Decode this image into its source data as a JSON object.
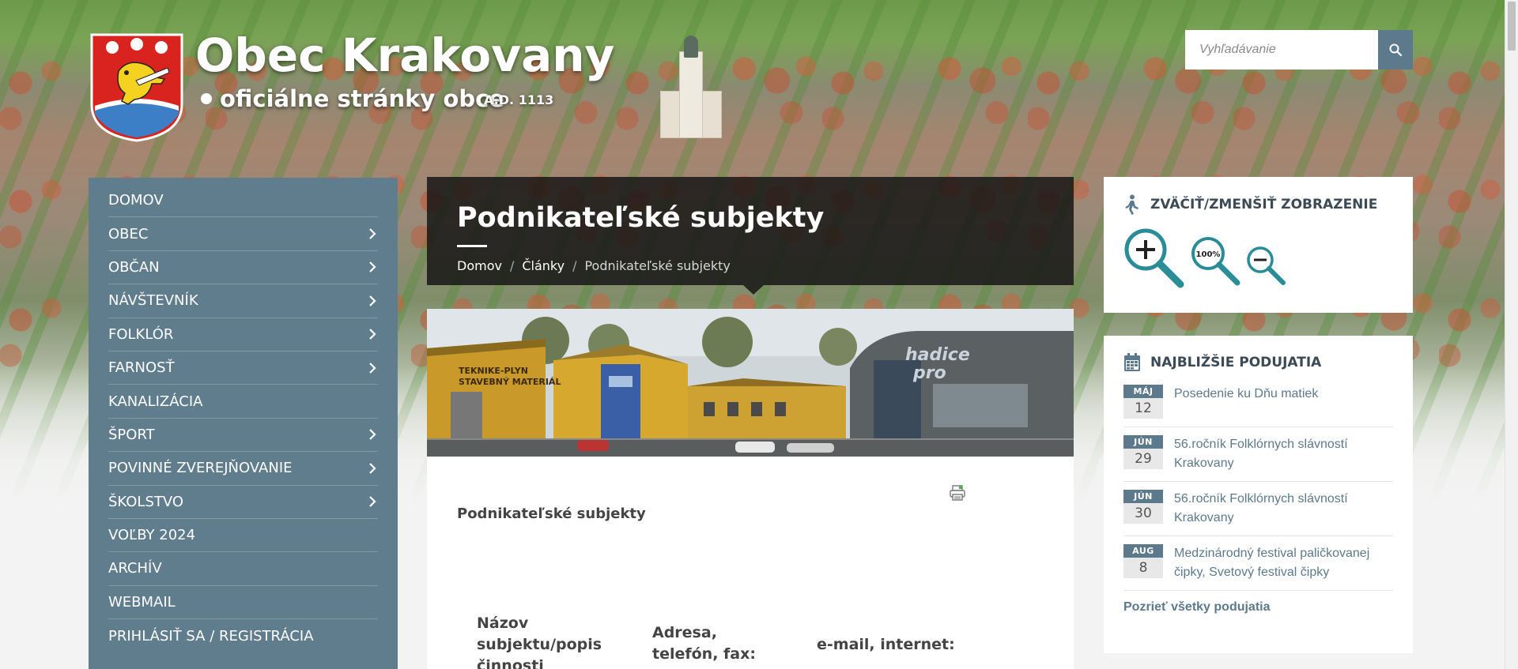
{
  "header": {
    "title": "Obec Krakovany",
    "subtitle": "oficiálne stránky obce",
    "year": "A.D. 1113"
  },
  "search": {
    "placeholder": "Vyhľadávanie"
  },
  "nav": {
    "items": [
      {
        "label": "DOMOV",
        "submenu": false
      },
      {
        "label": "OBEC",
        "submenu": true
      },
      {
        "label": "OBČAN",
        "submenu": true
      },
      {
        "label": "NÁVŠTEVNÍK",
        "submenu": true
      },
      {
        "label": "FOLKLÓR",
        "submenu": true
      },
      {
        "label": "FARNOSŤ",
        "submenu": true
      },
      {
        "label": "KANALIZÁCIA",
        "submenu": false
      },
      {
        "label": "ŠPORT",
        "submenu": true
      },
      {
        "label": "POVINNÉ ZVEREJŇOVANIE",
        "submenu": true
      },
      {
        "label": "ŠKOLSTVO",
        "submenu": true
      },
      {
        "label": "VOĽBY 2024",
        "submenu": false
      },
      {
        "label": "ARCHÍV",
        "submenu": false
      },
      {
        "label": "WEBMAIL",
        "submenu": false
      },
      {
        "label": "PRIHLÁSIŤ SA / REGISTRÁCIA",
        "submenu": false
      }
    ]
  },
  "page": {
    "title": "Podnikateľské subjekty",
    "breadcrumb": [
      "Domov",
      "Články",
      "Podnikateľské subjekty"
    ],
    "hero_signs": [
      "hadice",
      "pro",
      "TEKNIKE-PLYN",
      "STAVEBNÝ MATERIÁL"
    ],
    "content_heading": "Podnikateľské subjekty",
    "table_headers": [
      "Názov subjektu/popis činnosti",
      "Adresa, telefón, fax:",
      "e-mail, internet:"
    ]
  },
  "zoom_widget": {
    "title": "ZVÄČIŤ/ZMENŠIŤ ZOBRAZENIE",
    "reset_label": "100%"
  },
  "events_widget": {
    "title": "NAJBLIŽŠIE PODUJATIA",
    "events": [
      {
        "month": "MÁJ",
        "day": "12",
        "title": "Posedenie ku Dňu matiek"
      },
      {
        "month": "JÚN",
        "day": "29",
        "title": "56.ročník Folklórnych slávností Krakovany"
      },
      {
        "month": "JÚN",
        "day": "30",
        "title": "56.ročník Folklórnych slávností Krakovany"
      },
      {
        "month": "AUG",
        "day": "8",
        "title": "Medzinárodný festival paličkovanej čipky, Svetový festival čipky"
      }
    ],
    "all_link": "Pozrieť všetky podujatia"
  },
  "colors": {
    "nav_bg": "#607d8e",
    "accent": "#5d7a8c",
    "zoom_icon": "#2a8c96",
    "header_overlay": "#121212"
  },
  "icons": {
    "search": "search-icon",
    "chevron": "chevron-right-icon",
    "accessibility": "walking-person-icon",
    "calendar": "calendar-icon",
    "print": "print-icon",
    "zoom_in": "zoom-in-icon",
    "zoom_reset": "zoom-reset-icon",
    "zoom_out": "zoom-out-icon"
  }
}
